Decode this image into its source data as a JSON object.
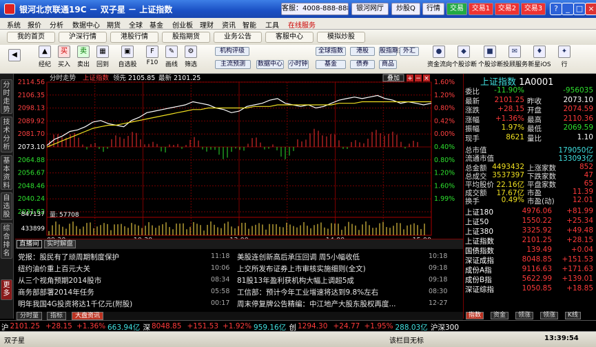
{
  "window": {
    "title": "银河北京联通19C － 双子星 － 上证指数",
    "service": "客服：4008-888-888",
    "buttons": [
      {
        "label": "银河网厅",
        "style": "w"
      },
      {
        "label": "炒股Q",
        "style": "w"
      },
      {
        "label": "行情",
        "style": "w"
      },
      {
        "label": "交易",
        "style": "g"
      },
      {
        "label": "交易1",
        "style": "r"
      },
      {
        "label": "交易2",
        "style": "r"
      },
      {
        "label": "交易3",
        "style": "r"
      }
    ],
    "controls": [
      "?",
      "_",
      "□",
      "×"
    ]
  },
  "menu": [
    "系统",
    "报价",
    "分析",
    "数据中心",
    "期货",
    "全球",
    "基金",
    "创业板",
    "理财",
    "资讯",
    "智能",
    "工具",
    "在线服务"
  ],
  "nav": [
    "我的首页",
    "沪深行情",
    "港股行情",
    "股指期货",
    "业务公告",
    "客服中心",
    "模拟炒股"
  ],
  "toolbar": {
    "left": [
      {
        "label": "",
        "icon": "◀"
      },
      {
        "label": "经纪",
        "icon": "▲"
      },
      {
        "label": "买入",
        "icon": "买"
      },
      {
        "label": "卖出",
        "icon": "卖"
      },
      {
        "label": "回到",
        "icon": "▦"
      },
      {
        "label": "自选股",
        "icon": "▣"
      },
      {
        "label": "F10",
        "icon": "F"
      },
      {
        "label": "画线",
        "icon": "✎"
      },
      {
        "label": "筛选",
        "icon": "⚙"
      }
    ],
    "pills": [
      "机构评级",
      "主流预测",
      "数据中心",
      "小时钟",
      "全球指数",
      "基金",
      "港股",
      "债券",
      "股指期货",
      "商品",
      "外汇"
    ],
    "right": [
      {
        "label": "资金流向",
        "icon": "●"
      },
      {
        "label": "个股诊断",
        "icon": "◆"
      },
      {
        "label": "个股诊断",
        "icon": "■"
      },
      {
        "label": "投顾服务",
        "icon": "✉"
      },
      {
        "label": "新星iOS",
        "icon": "♦"
      },
      {
        "label": "行",
        "icon": "✦"
      }
    ]
  },
  "sidetabs": [
    "分时走势",
    "技术分析",
    "基本资料",
    "自选股",
    "综合排名",
    "更多"
  ],
  "chart": {
    "mode": "分时走势",
    "title": "上证指数",
    "prev_label": "领先",
    "prev": "2105.85",
    "last_label": "最新",
    "last": "2101.25",
    "vol_label": "量",
    "vol": "57708",
    "btn": "叠加"
  },
  "chart_data": {
    "type": "line",
    "title": "上证指数 分时",
    "x_ticks": [
      "09:30",
      "10:30",
      "13:00",
      "14:00",
      "15:00"
    ],
    "prev_close": 2073.1,
    "ylim": [
      2031.62,
      2114.56
    ],
    "y_ticks": [
      "2114.56",
      "2106.35",
      "2098.13",
      "2089.92",
      "2081.70",
      "2073.10",
      "2064.88",
      "2056.67",
      "2048.46",
      "2040.24",
      "2031.62"
    ],
    "pct_ticks": [
      "1.60%",
      "1.20%",
      "0.80%",
      "0.42%",
      "0.00%",
      "0.40%",
      "0.80%",
      "1.20%",
      "1.60%",
      "1.99%"
    ],
    "vol_ticks": [
      "847137",
      "433899"
    ],
    "series": [
      {
        "name": "最新",
        "values": [
          2074,
          2078,
          2080,
          2083,
          2084,
          2086,
          2089,
          2090,
          2088,
          2087,
          2086,
          2090,
          2092,
          2095,
          2096,
          2097,
          2098,
          2099,
          2100,
          2102,
          2101,
          2100,
          2098,
          2097,
          2095,
          2096,
          2099,
          2100,
          2101,
          2103,
          2104,
          2101,
          2100,
          2099,
          2100,
          2098,
          2099,
          2101,
          2103,
          2104,
          2105,
          2104,
          2105,
          2106,
          2104,
          2103,
          2101,
          2102,
          2101,
          2100,
          2101
        ]
      },
      {
        "name": "均价",
        "values": [
          2073,
          2075,
          2077,
          2079,
          2081,
          2083,
          2085,
          2086,
          2087,
          2087,
          2088,
          2089,
          2090,
          2091,
          2092,
          2093,
          2094,
          2095,
          2096,
          2097,
          2097,
          2098,
          2098,
          2098,
          2098,
          2098,
          2098,
          2099,
          2099,
          2099,
          2100,
          2100,
          2100,
          2100,
          2100,
          2100,
          2100,
          2100,
          2101,
          2101,
          2101,
          2102,
          2102,
          2102,
          2102,
          2102,
          2102,
          2102,
          2102,
          2102,
          2102
        ]
      }
    ]
  },
  "quote": {
    "name": "上证指数",
    "code": "1A0001",
    "rows": [
      {
        "l": "委比",
        "v": "-11.90%",
        "vc": "grn",
        "l2": "",
        "v2": "-956035",
        "v2c": "grn"
      },
      {
        "l": "最新",
        "v": "2101.25",
        "vc": "red",
        "l2": "昨收",
        "v2": "2073.10",
        "v2c": "wht"
      },
      {
        "l": "涨跌",
        "v": "+28.15",
        "vc": "red",
        "l2": "开盘",
        "v2": "2074.59",
        "v2c": "red"
      },
      {
        "l": "涨幅",
        "v": "+1.36%",
        "vc": "red",
        "l2": "最高",
        "v2": "2110.36",
        "v2c": "red"
      },
      {
        "l": "振幅",
        "v": "1.97%",
        "vc": "yel",
        "l2": "最低",
        "v2": "2069.59",
        "v2c": "grn"
      },
      {
        "l": "现手",
        "v": "8621",
        "vc": "yel",
        "l2": "量比",
        "v2": "1.10",
        "v2c": "wht"
      }
    ],
    "cap": [
      {
        "l": "总市值",
        "v": "179050亿"
      },
      {
        "l": "流通市值",
        "v": "133093亿"
      }
    ],
    "stats": [
      {
        "l": "总金额",
        "v": "4493432",
        "l2": "上涨家数",
        "v2": "852"
      },
      {
        "l": "总成交",
        "v": "3537397",
        "l2": "下跌家数",
        "v2": "47"
      },
      {
        "l": "平均股价",
        "v": "22.16亿",
        "l2": "平盘家数",
        "v2": "65"
      },
      {
        "l": "成交额",
        "v": "17.67亿",
        "l2": "市盈",
        "v2": "11.39"
      },
      {
        "l": "换手",
        "v": "0.49%",
        "l2": "市盈(动)",
        "v2": "12.01"
      }
    ],
    "indices": [
      {
        "n": "上证180",
        "p": "4976.06",
        "c": "+81.99",
        "cls": "red"
      },
      {
        "n": "上证50",
        "p": "1550.22",
        "c": "+25.34",
        "cls": "red"
      },
      {
        "n": "上证380",
        "p": "3325.92",
        "c": "+49.48",
        "cls": "red"
      },
      {
        "n": "上证指数",
        "p": "2101.25",
        "c": "+28.15",
        "cls": "red"
      },
      {
        "n": "国债指数",
        "p": "139.49",
        "c": "+0.04",
        "cls": "red"
      },
      {
        "n": "深证成指",
        "p": "8048.85",
        "c": "+151.53",
        "cls": "red"
      },
      {
        "n": "成份A指",
        "p": "9116.63",
        "c": "+171.63",
        "cls": "red"
      },
      {
        "n": "成份B指",
        "p": "5622.99",
        "c": "+139.01",
        "cls": "red"
      },
      {
        "n": "深证综指",
        "p": "1050.85",
        "c": "+18.85",
        "cls": "red"
      }
    ],
    "tabs": [
      "指数",
      "资金",
      "领涨",
      "领涨",
      "K线"
    ]
  },
  "news": {
    "tabs": [
      "直播间",
      "实时解盘"
    ],
    "left": [
      {
        "t": "党报：股民有了顽周期制度保护",
        "time": "11:18"
      },
      {
        "t": "纽约油价重上百元大关",
        "time": "10:06"
      },
      {
        "t": "从三个视角预期2014股市",
        "time": "08:34"
      },
      {
        "t": "商务部部署2014年任务",
        "time": "05:58"
      },
      {
        "t": "明年我国4G投资将达1千亿元(附股)",
        "time": "00:17"
      }
    ],
    "right": [
      {
        "t": "美股连创新高后承压回调 周5小幅收低",
        "time": "10:18"
      },
      {
        "t": "上交所发布证券上市审核实施细则(全文)",
        "time": "09:18"
      },
      {
        "t": "81股13年盈利获机构大幅上调超5成",
        "time": "09:18"
      },
      {
        "t": "工信部：预计今年工业增速将达到9.8%左右",
        "time": "08:30"
      },
      {
        "t": "周末停复牌公告精编：中江地产大股东股权再度...",
        "time": "12-27"
      }
    ]
  },
  "bottomtabs": [
    "分时量",
    "指标",
    "大盘资讯"
  ],
  "ticker": [
    {
      "t": "沪",
      "c": "wht"
    },
    {
      "t": "2101.25",
      "c": "red"
    },
    {
      "t": "+28.15",
      "c": "red"
    },
    {
      "t": "+1.36%",
      "c": "red"
    },
    {
      "t": "663.94亿",
      "c": "cyn"
    },
    {
      "t": "深",
      "c": "wht"
    },
    {
      "t": "8048.85",
      "c": "red"
    },
    {
      "t": "+151.53",
      "c": "red"
    },
    {
      "t": "+1.92%",
      "c": "red"
    },
    {
      "t": "959.16亿",
      "c": "cyn"
    },
    {
      "t": "创",
      "c": "wht"
    },
    {
      "t": "1294.30",
      "c": "red"
    },
    {
      "t": "+24.77",
      "c": "red"
    },
    {
      "t": "+1.95%",
      "c": "red"
    },
    {
      "t": "288.03亿",
      "c": "cyn"
    },
    {
      "t": "沪深300",
      "c": "wht"
    }
  ],
  "status": {
    "left": "双子星",
    "mid": "该栏目无标",
    "time": "13:39:54"
  }
}
